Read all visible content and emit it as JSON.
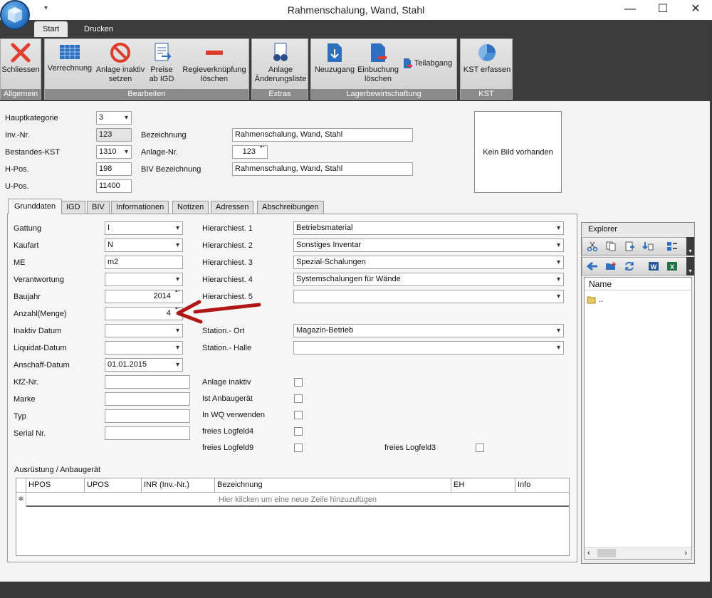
{
  "window": {
    "title": "Rahmenschalung, Wand, Stahl"
  },
  "ribbon": {
    "tabs": [
      {
        "label": "Start"
      },
      {
        "label": "Drucken"
      }
    ],
    "groups": {
      "allgemein": {
        "label": "Allgemein",
        "close": "Schliessen"
      },
      "bearbeiten": {
        "label": "Bearbeiten",
        "verrechnung": "Verrechnung",
        "inaktiv_1": "Anlage inaktiv",
        "inaktiv_2": "setzen",
        "preise_1": "Preise",
        "preise_2": "ab IGD",
        "regie_1": "Regieverknüpfung",
        "regie_2": "löschen"
      },
      "extras": {
        "label": "Extras",
        "aend_1": "Anlage",
        "aend_2": "Änderungsliste"
      },
      "lager": {
        "label": "Lagerbewirtschaftung",
        "neuzugang": "Neuzugang",
        "einbuchung_1": "Einbuchung",
        "einbuchung_2": "löschen",
        "teilabgang": "Teilabgang"
      },
      "kst": {
        "label": "KST",
        "erfassen": "KST erfassen"
      }
    }
  },
  "header": {
    "hauptkategorie": {
      "label": "Hauptkategorie",
      "value": "3"
    },
    "inv_nr": {
      "label": "Inv.-Nr.",
      "value": "123"
    },
    "bestandes_kst": {
      "label": "Bestandes-KST",
      "value": "1310"
    },
    "h_pos": {
      "label": "H-Pos.",
      "value": "198"
    },
    "u_pos": {
      "label": "U-Pos.",
      "value": "11400"
    },
    "bezeichnung": {
      "label": "Bezeichnung",
      "value": "Rahmenschalung, Wand, Stahl"
    },
    "anlage_nr": {
      "label": "Anlage-Nr.",
      "value": "123"
    },
    "biv_bezeichnung": {
      "label": "BIV Bezeichnung",
      "value": "Rahmenschalung, Wand, Stahl"
    },
    "picture": "Kein Bild vorhanden"
  },
  "tabs": [
    "Grunddaten",
    "IGD",
    "BIV",
    "Informationen",
    "Notizen",
    "Adressen",
    "Abschreibungen"
  ],
  "grunddaten": {
    "gattung": {
      "label": "Gattung",
      "value": "I"
    },
    "kaufart": {
      "label": "Kaufart",
      "value": "N"
    },
    "me": {
      "label": "ME",
      "value": "m2"
    },
    "verantwortung": {
      "label": "Verantwortung",
      "value": ""
    },
    "baujahr": {
      "label": "Baujahr",
      "value": "2014"
    },
    "anzahl": {
      "label": "Anzahl(Menge)",
      "value": "4"
    },
    "inaktiv_datum": {
      "label": "Inaktiv Datum",
      "value": ""
    },
    "liquidat_datum": {
      "label": "Liquidat-Datum",
      "value": ""
    },
    "anschaff_datum": {
      "label": "Anschaff-Datum",
      "value": "01.01.2015"
    },
    "kfz_nr": {
      "label": "KfZ-Nr.",
      "value": ""
    },
    "marke": {
      "label": "Marke",
      "value": ""
    },
    "typ": {
      "label": "Typ",
      "value": ""
    },
    "serial_nr": {
      "label": "Serial Nr.",
      "value": ""
    },
    "hier1": {
      "label": "Hierarchiest. 1",
      "value": "Betriebsmaterial"
    },
    "hier2": {
      "label": "Hierarchiest. 2",
      "value": "Sonstiges Inventar"
    },
    "hier3": {
      "label": "Hierarchiest. 3",
      "value": "Spezial-Schalungen"
    },
    "hier4": {
      "label": "Hierarchiest. 4",
      "value": "Systemschalungen für Wände"
    },
    "hier5": {
      "label": "Hierarchiest. 5",
      "value": ""
    },
    "station_ort": {
      "label": "Station.- Ort",
      "value": "Magazin-Betrieb"
    },
    "station_halle": {
      "label": "Station.- Halle",
      "value": ""
    },
    "anlage_inaktiv": "Anlage inaktiv",
    "ist_anbaugeraet": "Ist Anbaugerät",
    "in_wq": "In WQ verwenden",
    "logfeld4": "freies Logfeld4",
    "logfeld9": "freies Logfeld9",
    "logfeld3": "freies Logfeld3"
  },
  "ausruestung": {
    "title": "Ausrüstung / Anbaugerät",
    "columns": [
      "HPOS",
      "UPOS",
      "INR (Inv.-Nr.)",
      "Bezeichnung",
      "EH",
      "Info"
    ],
    "new_row_hint": "Hier klicken um eine neue Zeile hinzuzufügen"
  },
  "explorer": {
    "title": "Explorer",
    "column": "Name",
    "items": [
      ".."
    ]
  }
}
